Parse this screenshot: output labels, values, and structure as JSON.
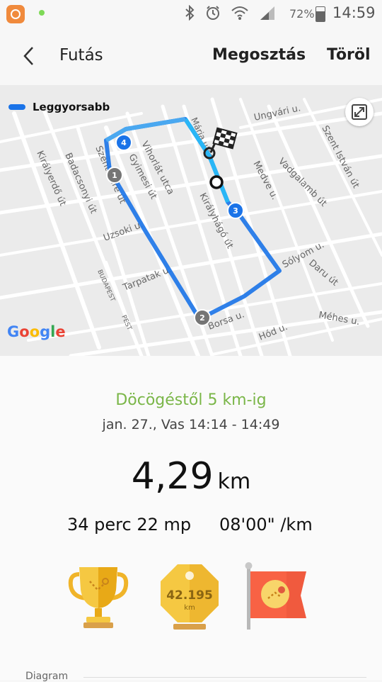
{
  "status_bar": {
    "battery_percent": "72%",
    "time": "14:59",
    "icons": [
      "app-notification-icon",
      "bluetooth-icon",
      "alarm-icon",
      "wifi-icon",
      "signal-icon",
      "battery-icon"
    ]
  },
  "header": {
    "title": "Futás",
    "share_label": "Megosztás",
    "delete_label": "Töröl"
  },
  "map": {
    "legend_label": "Leggyorsabb",
    "route_color": "#1a73e8",
    "streets": [
      "Ungvári u.",
      "Szent István út",
      "Vadgalamb út",
      "Medve u.",
      "Vihorlát utca",
      "Gyimesi út",
      "Királyerdő út",
      "Badacsonyi út",
      "Szent Imre út",
      "Uzsoki u.",
      "Királyhágó út",
      "Sólyom u.",
      "Daru út",
      "Tarpatak u.",
      "Borsa u.",
      "Méhes u.",
      "Hód u.",
      "BUDAPEST",
      "PEST",
      "Mária utca"
    ],
    "markers": [
      "1",
      "2",
      "3",
      "4"
    ],
    "google_text": [
      "G",
      "o",
      "o",
      "g",
      "l",
      "e"
    ]
  },
  "summary": {
    "workout_name": "Döcögéstől 5 km-ig",
    "date": "jan. 27., Vas 14:14 - 14:49",
    "distance_value": "4,29",
    "distance_unit": "km",
    "duration": "34 perc 22 mp",
    "pace": "08'00\" /km",
    "badge_marathon_value": "42.195",
    "badge_marathon_unit": "km",
    "diagram_label": "Diagram",
    "accent_color": "#7ab648"
  }
}
